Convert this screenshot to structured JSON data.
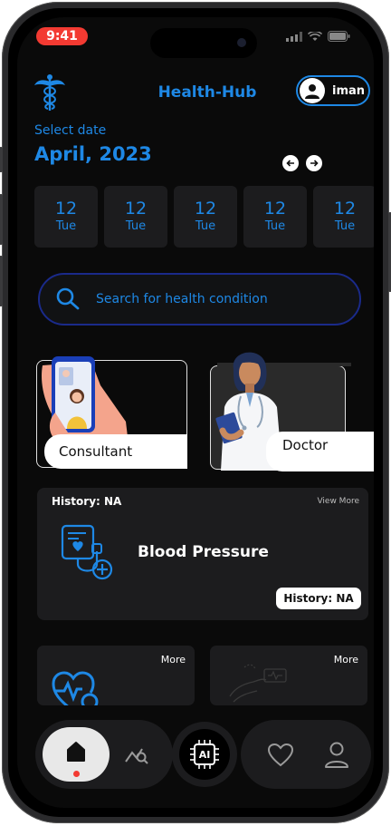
{
  "status": {
    "time": "9:41"
  },
  "header": {
    "title": "Health-Hub",
    "user_name": "iman"
  },
  "calendar": {
    "select_label": "Select date",
    "month": "April, 2023",
    "days": [
      {
        "num": "12",
        "day": "Tue"
      },
      {
        "num": "12",
        "day": "Tue"
      },
      {
        "num": "12",
        "day": "Tue"
      },
      {
        "num": "12",
        "day": "Tue"
      },
      {
        "num": "12",
        "day": "Tue"
      }
    ]
  },
  "search": {
    "placeholder": "Search for health condition"
  },
  "categories": {
    "consultant": "Consultant",
    "doctor": "Doctor"
  },
  "history": {
    "title": "History: NA",
    "view_more": "View More",
    "metric": "Blood Pressure",
    "badge": "History: NA"
  },
  "mini_cards": [
    {
      "more": "More"
    },
    {
      "more": "More"
    }
  ],
  "nav": {
    "ai_label": "AI"
  },
  "colors": {
    "accent": "#1e88e5",
    "background": "#0a0a0a",
    "card": "#1c1c1e",
    "status_pill": "#f33a32"
  }
}
